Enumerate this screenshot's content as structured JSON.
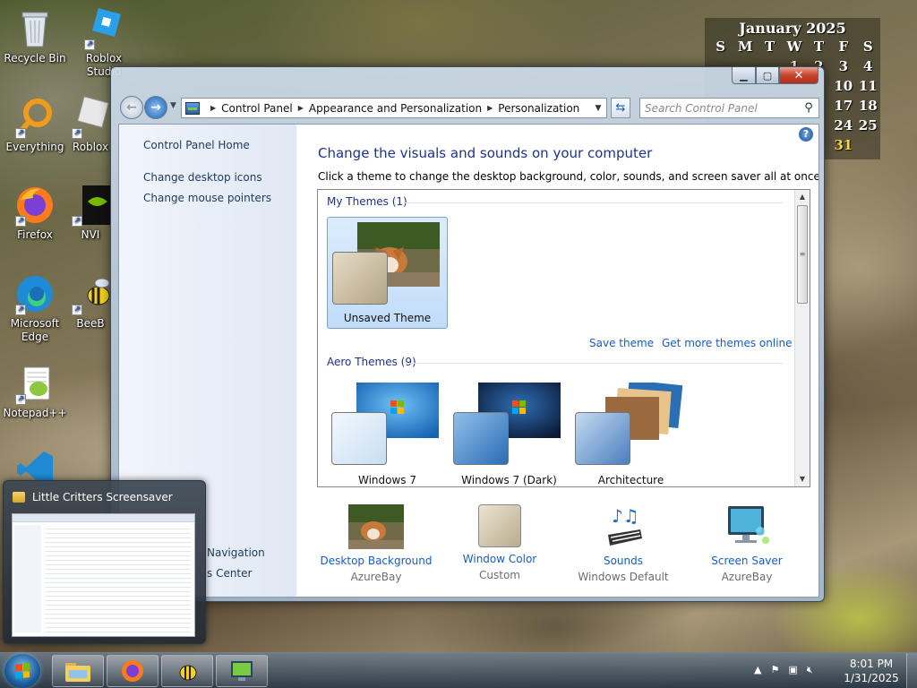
{
  "desktop": {
    "icons": [
      {
        "label": "Recycle Bin"
      },
      {
        "label": "Roblox Studio"
      },
      {
        "label": "Everything"
      },
      {
        "label": "Roblox"
      },
      {
        "label": "Firefox"
      },
      {
        "label": "NVI"
      },
      {
        "label": "Microsoft Edge"
      },
      {
        "label": "BeeB"
      },
      {
        "label": "Notepad++"
      }
    ]
  },
  "calendar": {
    "title": "January 2025",
    "days": [
      "S",
      "M",
      "T",
      "W",
      "T",
      "F",
      "S"
    ],
    "rows": [
      [
        "",
        "",
        "",
        "1",
        "2",
        "3",
        "4"
      ],
      [
        "",
        "",
        "",
        "",
        "",
        "10",
        "11"
      ],
      [
        "",
        "",
        "",
        "",
        "",
        "17",
        "18"
      ],
      [
        "",
        "",
        "",
        "",
        "",
        "24",
        "25"
      ],
      [
        "",
        "",
        "",
        "",
        "",
        "31",
        ""
      ]
    ],
    "today": "31"
  },
  "window": {
    "address": {
      "crumbs": [
        "Control Panel",
        "Appearance and Personalization",
        "Personalization"
      ]
    },
    "search_placeholder": "Search Control Panel",
    "left_links": {
      "home": "Control Panel Home",
      "desktop_icons": "Change desktop icons",
      "mouse_pointers": "Change mouse pointers",
      "see_also_1": "Navigation",
      "see_also_2": "s Center"
    },
    "heading": "Change the visuals and sounds on your computer",
    "subheading": "Click a theme to change the desktop background, color, sounds, and screen saver all at once.",
    "my_themes": {
      "label": "My Themes (1)",
      "items": [
        {
          "name": "Unsaved Theme"
        }
      ]
    },
    "save_theme": "Save theme",
    "get_more": "Get more themes online",
    "aero_themes": {
      "label": "Aero Themes (9)",
      "items": [
        {
          "name": "Windows 7"
        },
        {
          "name": "Windows 7 (Dark)"
        },
        {
          "name": "Architecture"
        }
      ]
    },
    "bottom": [
      {
        "link": "Desktop Background",
        "value": "AzureBay"
      },
      {
        "link": "Window Color",
        "value": "Custom"
      },
      {
        "link": "Sounds",
        "value": "Windows Default"
      },
      {
        "link": "Screen Saver",
        "value": "AzureBay"
      }
    ]
  },
  "thumbnail": {
    "title": "Little Critters Screensaver"
  },
  "taskbar": {
    "time": "8:01 PM",
    "date": "1/31/2025"
  },
  "colors": {
    "link": "#1a5dbd",
    "heading": "#1e3287",
    "close": "#c7432a"
  }
}
